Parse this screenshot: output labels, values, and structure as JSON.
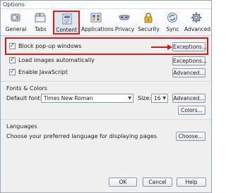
{
  "window": {
    "title": "Options"
  },
  "tabs": [
    {
      "label": "General",
      "icon": "general-switch-icon"
    },
    {
      "label": "Tabs",
      "icon": "tabs-icon"
    },
    {
      "label": "Content",
      "icon": "content-icon"
    },
    {
      "label": "Applications",
      "icon": "applications-icon"
    },
    {
      "label": "Privacy",
      "icon": "privacy-mask-icon"
    },
    {
      "label": "Security",
      "icon": "security-lock-icon"
    },
    {
      "label": "Sync",
      "icon": "sync-icon"
    },
    {
      "label": "Advanced",
      "icon": "advanced-gear-icon"
    }
  ],
  "selected_tab": "Content",
  "content": {
    "block_popups": {
      "label": "Block pop-up windows",
      "checked": true,
      "button": "Exceptions..."
    },
    "load_images": {
      "label": "Load images automatically",
      "checked": true,
      "button": "Exceptions..."
    },
    "enable_js": {
      "label": "Enable JavaScript",
      "checked": true,
      "button": "Advanced..."
    },
    "fonts": {
      "section_title": "Fonts & Colors",
      "default_font_label": "Default font:",
      "default_font_value": "Times New Roman",
      "size_label": "Size:",
      "size_value": "16",
      "advanced_button": "Advanced...",
      "colors_button": "Colors..."
    },
    "languages": {
      "section_title": "Languages",
      "description": "Choose your preferred language for displaying pages",
      "choose_button": "Choose..."
    }
  },
  "footer": {
    "ok": "OK",
    "cancel": "Cancel",
    "help": "Help"
  },
  "colors": {
    "highlight_red": "#d21c1c",
    "selected_tab_bg": "#dfe6ef"
  }
}
